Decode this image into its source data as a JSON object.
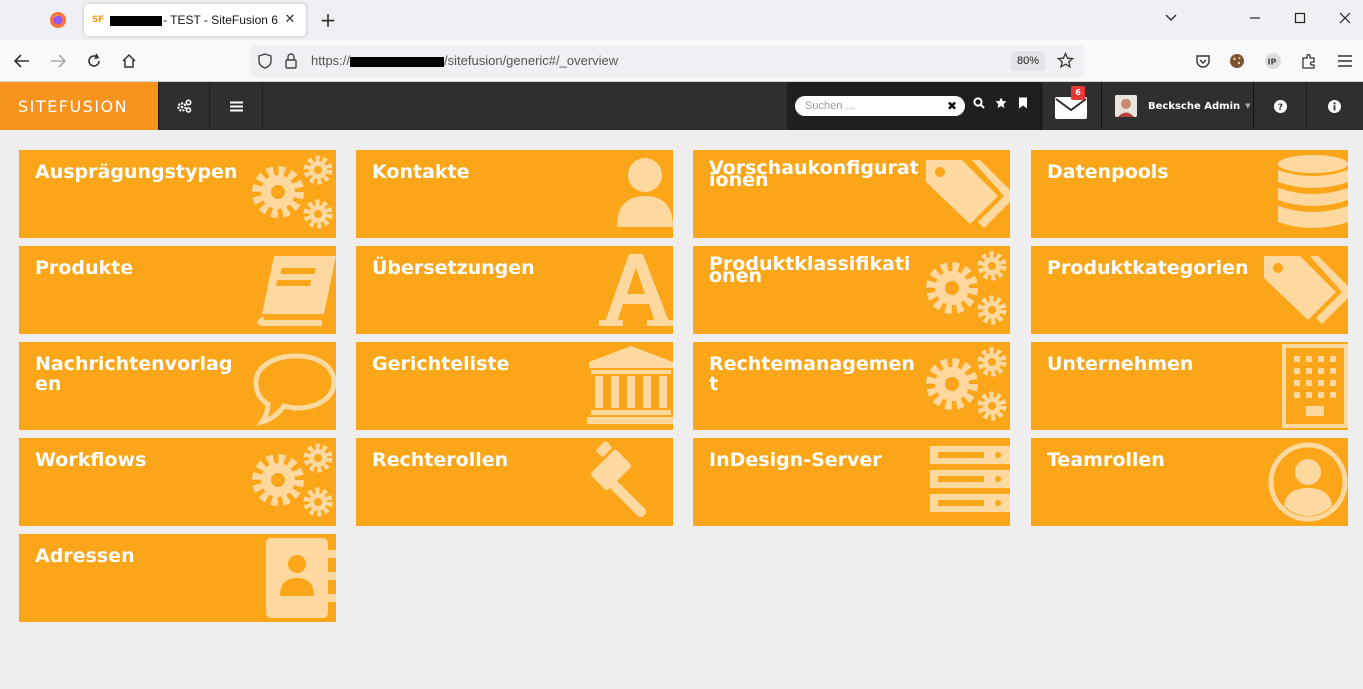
{
  "browser": {
    "tab_title": "- TEST - SiteFusion 6",
    "tab_favicon": "SF",
    "url_visible_suffix": "/sitefusion/generic#/_overview",
    "url_prefix": "https://",
    "zoom": "80%"
  },
  "app": {
    "logo": "SITEFUSION",
    "search_placeholder": "Suchen ...",
    "mail_count": "6",
    "user_name": "Becksche Admin"
  },
  "tiles": [
    {
      "label": "Ausprägungstypen",
      "icon": "gears-icon"
    },
    {
      "label": "Kontakte",
      "icon": "user-icon"
    },
    {
      "label": "Vorschaukonfigurationen",
      "icon": "tags-icon"
    },
    {
      "label": "Datenpools",
      "icon": "database-icon"
    },
    {
      "label": "Produkte",
      "icon": "book-icon"
    },
    {
      "label": "Übersetzungen",
      "icon": "font-icon"
    },
    {
      "label": "Produktklassifikationen",
      "icon": "gears-icon"
    },
    {
      "label": "Produktkategorien",
      "icon": "tags-icon"
    },
    {
      "label": "Nachrichtenvorlagen",
      "icon": "comment-icon"
    },
    {
      "label": "Gerichteliste",
      "icon": "bank-icon"
    },
    {
      "label": "Rechtemanagement",
      "icon": "gears-icon"
    },
    {
      "label": "Unternehmen",
      "icon": "building-icon"
    },
    {
      "label": "Workflows",
      "icon": "gears-icon"
    },
    {
      "label": "Rechterollen",
      "icon": "gavel-icon"
    },
    {
      "label": "InDesign-Server",
      "icon": "server-icon"
    },
    {
      "label": "Teamrollen",
      "icon": "user-circle-icon"
    },
    {
      "label": "Adressen",
      "icon": "address-book-icon"
    }
  ],
  "colors": {
    "tile": "#fba519",
    "tile_icon": "#fdd9a0",
    "header": "#2f2f2f",
    "logo_bg": "#f7941d"
  }
}
